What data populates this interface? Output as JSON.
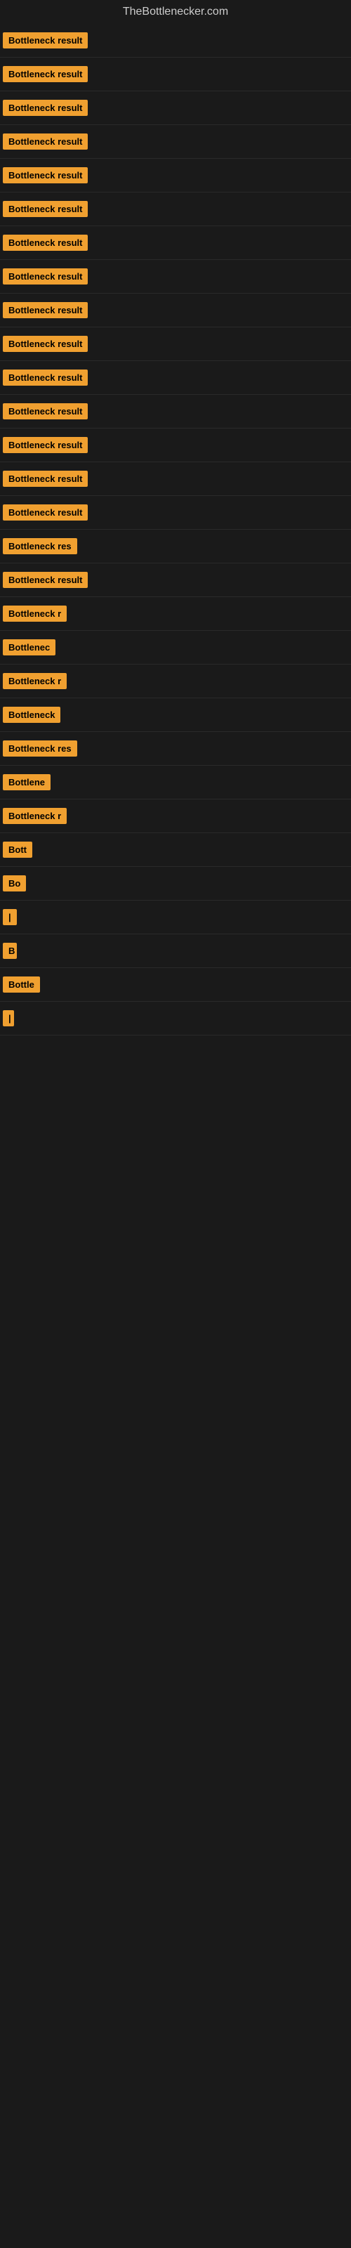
{
  "site": {
    "title": "TheBottlenecker.com"
  },
  "items": [
    {
      "label": "Bottleneck result",
      "width_class": "width-full"
    },
    {
      "label": "Bottleneck result",
      "width_class": "width-full"
    },
    {
      "label": "Bottleneck result",
      "width_class": "width-full"
    },
    {
      "label": "Bottleneck result",
      "width_class": "width-full"
    },
    {
      "label": "Bottleneck result",
      "width_class": "width-full"
    },
    {
      "label": "Bottleneck result",
      "width_class": "width-full"
    },
    {
      "label": "Bottleneck result",
      "width_class": "width-full"
    },
    {
      "label": "Bottleneck result",
      "width_class": "width-full"
    },
    {
      "label": "Bottleneck result",
      "width_class": "width-full"
    },
    {
      "label": "Bottleneck result",
      "width_class": "width-full"
    },
    {
      "label": "Bottleneck result",
      "width_class": "width-full"
    },
    {
      "label": "Bottleneck result",
      "width_class": "width-full"
    },
    {
      "label": "Bottleneck result",
      "width_class": "width-full"
    },
    {
      "label": "Bottleneck result",
      "width_class": "width-full"
    },
    {
      "label": "Bottleneck result",
      "width_class": "width-full"
    },
    {
      "label": "Bottleneck res",
      "width_class": "width-lg"
    },
    {
      "label": "Bottleneck result",
      "width_class": "width-full"
    },
    {
      "label": "Bottleneck r",
      "width_class": "width-md"
    },
    {
      "label": "Bottlenec",
      "width_class": "width-sm"
    },
    {
      "label": "Bottleneck r",
      "width_class": "width-md"
    },
    {
      "label": "Bottleneck",
      "width_class": "width-sm"
    },
    {
      "label": "Bottleneck res",
      "width_class": "width-lg"
    },
    {
      "label": "Bottlene",
      "width_class": "width-xs"
    },
    {
      "label": "Bottleneck r",
      "width_class": "width-md"
    },
    {
      "label": "Bott",
      "width_class": "width-xxs"
    },
    {
      "label": "Bo",
      "width_class": "width-xxxs"
    },
    {
      "label": "|",
      "width_class": "width-tiny"
    },
    {
      "label": "B",
      "width_class": "width-micro"
    },
    {
      "label": "Bottle",
      "width_class": "width-xxs"
    },
    {
      "label": "|",
      "width_class": "width-nano"
    }
  ]
}
